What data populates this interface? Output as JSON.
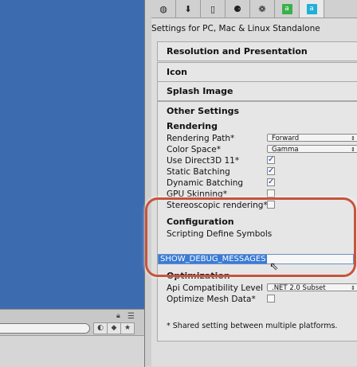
{
  "inspector": {
    "settings_for": "Settings for PC, Mac & Linux Standalone",
    "platform_tabs": [
      {
        "icon": "globe-icon",
        "glyph": "◍"
      },
      {
        "icon": "download-icon",
        "glyph": "⬇"
      },
      {
        "icon": "phone-icon",
        "glyph": "▯"
      },
      {
        "icon": "android-icon",
        "glyph": "⚈"
      },
      {
        "icon": "blackberry-icon",
        "glyph": "❁"
      },
      {
        "icon": "green-a-icon",
        "glyph": "a"
      },
      {
        "icon": "blue-a-icon",
        "glyph": "a"
      }
    ],
    "sections": {
      "resolution": "Resolution and Presentation",
      "icon": "Icon",
      "splash": "Splash Image",
      "other": "Other Settings"
    },
    "rendering": {
      "title": "Rendering",
      "rendering_path_label": "Rendering Path*",
      "rendering_path_value": "Forward",
      "color_space_label": "Color Space*",
      "color_space_value": "Gamma",
      "d3d11_label": "Use Direct3D 11*",
      "d3d11_checked": true,
      "static_batching_label": "Static Batching",
      "static_batching_checked": true,
      "dynamic_batching_label": "Dynamic Batching",
      "dynamic_batching_checked": true,
      "gpu_skinning_label": "GPU Skinning*",
      "gpu_skinning_checked": false,
      "stereo_label": "Stereoscopic rendering*",
      "stereo_checked": false
    },
    "configuration": {
      "title": "Configuration",
      "define_symbols_label": "Scripting Define Symbols",
      "define_symbols_value": "SHOW_DEBUG_MESSAGES"
    },
    "optimization": {
      "title": "Optimization",
      "api_label": "Api Compatibility Level",
      "api_value": ".NET 2.0 Subset",
      "optimize_mesh_label": "Optimize Mesh Data*",
      "optimize_mesh_checked": false
    },
    "footnote": "* Shared setting between multiple platforms."
  },
  "colors": {
    "scene_blue": "#3d6bb0",
    "highlight_ring": "#c8543b",
    "selection": "#3a7bd5",
    "check": "#1e3f9e"
  }
}
